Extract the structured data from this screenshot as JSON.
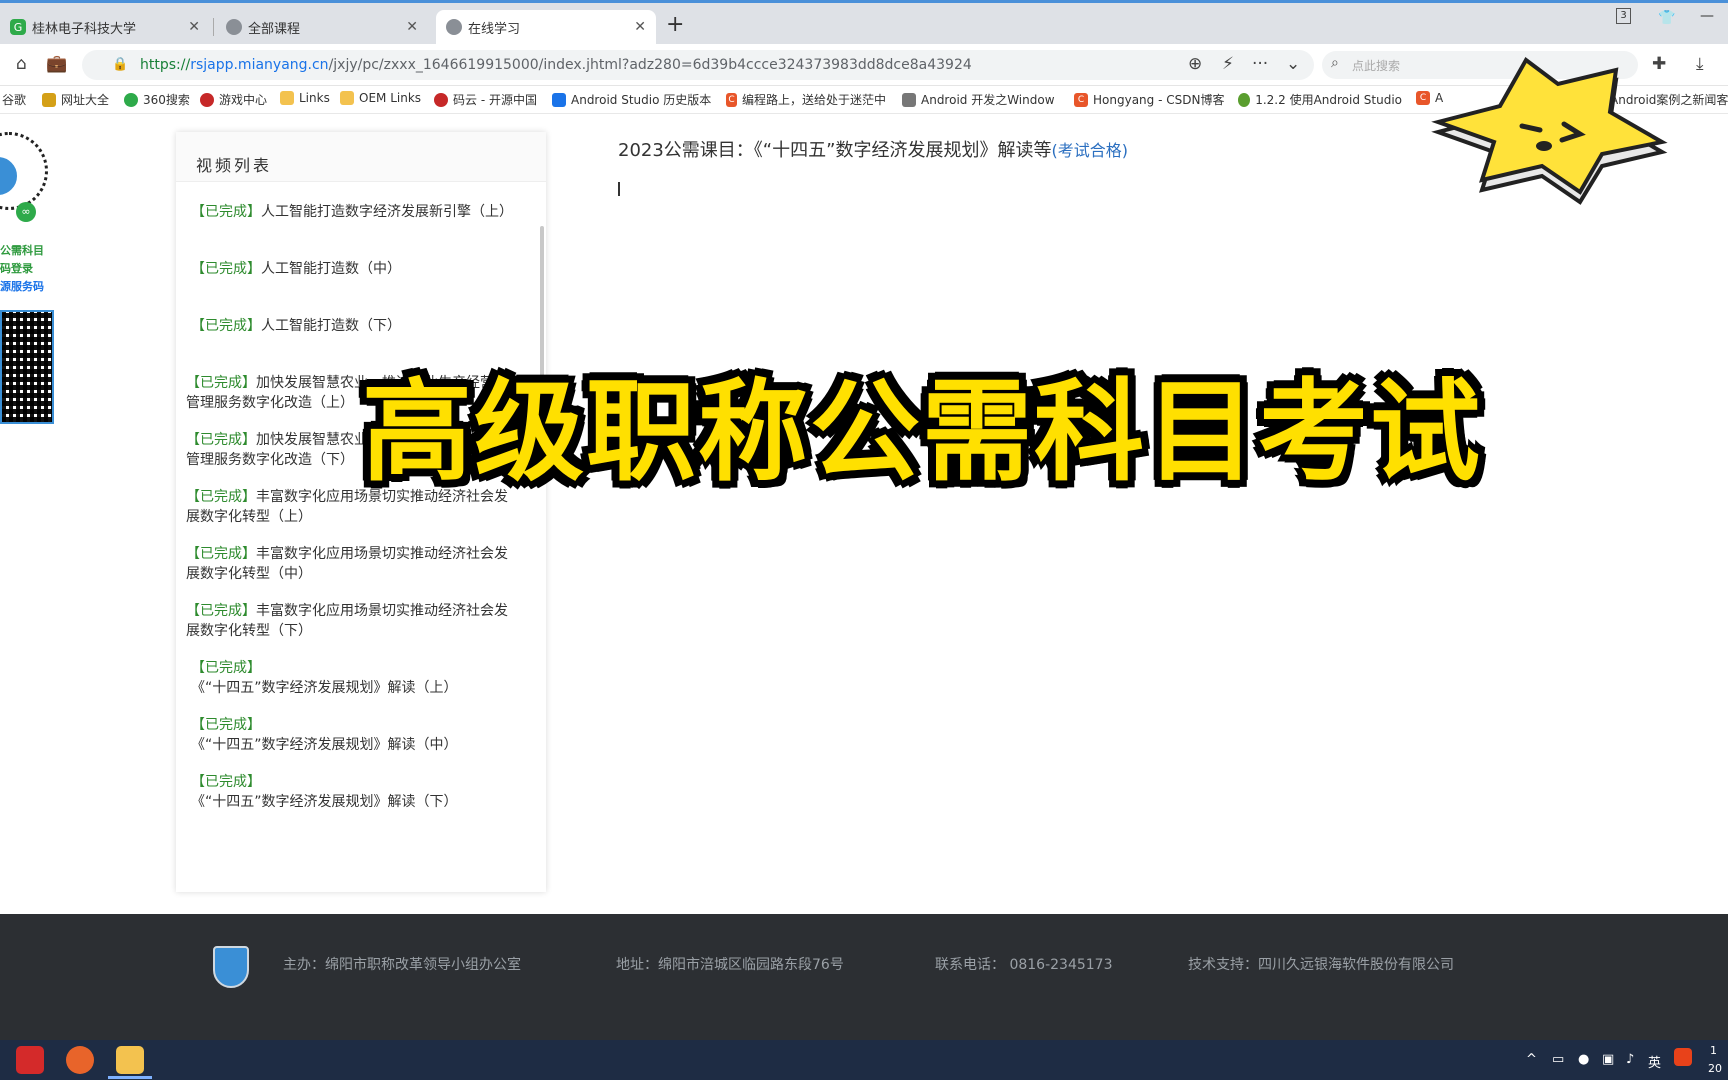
{
  "browser": {
    "tabs": [
      {
        "label": "桂林电子科技大学",
        "active": false
      },
      {
        "label": "全部课程",
        "active": false
      },
      {
        "label": "在线学习",
        "active": true
      }
    ],
    "tab_count_badge": "3",
    "url_scheme": "https://",
    "url_host": "rsjapp.mianyang.cn",
    "url_path": "/jxjy/pc/zxxx_1646619915000/index.jhtml?adz280=6d39b4ccce324373983dd8dce8a43924",
    "search_placeholder": "点此搜索",
    "bookmarks": [
      "谷歌",
      "网址大全",
      "360搜索",
      "游戏中心",
      "Links",
      "OEM Links",
      "码云 - 开源中国",
      "Android Studio 历史版本",
      "编程路上，送给处于迷茫中",
      "Android 开发之Window",
      "Hongyang - CSDN博客",
      "1.2.2 使用Android Studio",
      "A",
      "Android案例之新闻客"
    ]
  },
  "promo": {
    "lines": [
      "公需科目",
      "码登录",
      "源服务码"
    ]
  },
  "video_panel": {
    "header": "视频列表",
    "status_label": "【已完成】",
    "items": [
      {
        "status": "【已完成】",
        "title": "人工智能打造数字经济发展新引擎（上）"
      },
      {
        "status": "【已完成】",
        "title": "人工智能打造数（中）"
      },
      {
        "status": "【已完成】",
        "title": "人工智能打造数（下）"
      },
      {
        "status": "【已完成】",
        "title": "加快发展智慧农业，推进农业生产经营和管理服务数字化改造（上）"
      },
      {
        "status": "【已完成】",
        "title": "加快发展智慧农业，推进农业生产经营和管理服务数字化改造（下）"
      },
      {
        "status": "【已完成】",
        "title": "丰富数字化应用场景切实推动经济社会发展数字化转型（上）"
      },
      {
        "status": "【已完成】",
        "title": "丰富数字化应用场景切实推动经济社会发展数字化转型（中）"
      },
      {
        "status": "【已完成】",
        "title": "丰富数字化应用场景切实推动经济社会发展数字化转型（下）"
      },
      {
        "status": "【已完成】",
        "title": "《“十四五”数字经济发展规划》解读（上）"
      },
      {
        "status": "【已完成】",
        "title": "《“十四五”数字经济发展规划》解读（中）"
      },
      {
        "status": "【已完成】",
        "title": "《“十四五”数字经济发展规划》解读（下）"
      }
    ]
  },
  "course": {
    "title": "2023公需课目：《“十四五”数字经济发展规划》解读等",
    "status": "(考试合格)"
  },
  "overlay_title": "高级职称公需科目考试",
  "footer": {
    "organizer": "主办：绵阳市职称改革领导小组办公室",
    "address": "地址：绵阳市涪城区临园路东段76号",
    "phone": "联系电话：  0816-2345173",
    "support": "技术支持：四川久远银海软件股份有限公司"
  },
  "taskbar": {
    "ime": "英",
    "clock_line1": "1",
    "clock_line2": "20"
  },
  "colors": {
    "done_green": "#2e8b2e",
    "pass_blue": "#2b6fc0",
    "overlay_yellow": "#ffe000",
    "footer_bg": "#2c2f33",
    "taskbar_bg": "#1e2c44"
  }
}
